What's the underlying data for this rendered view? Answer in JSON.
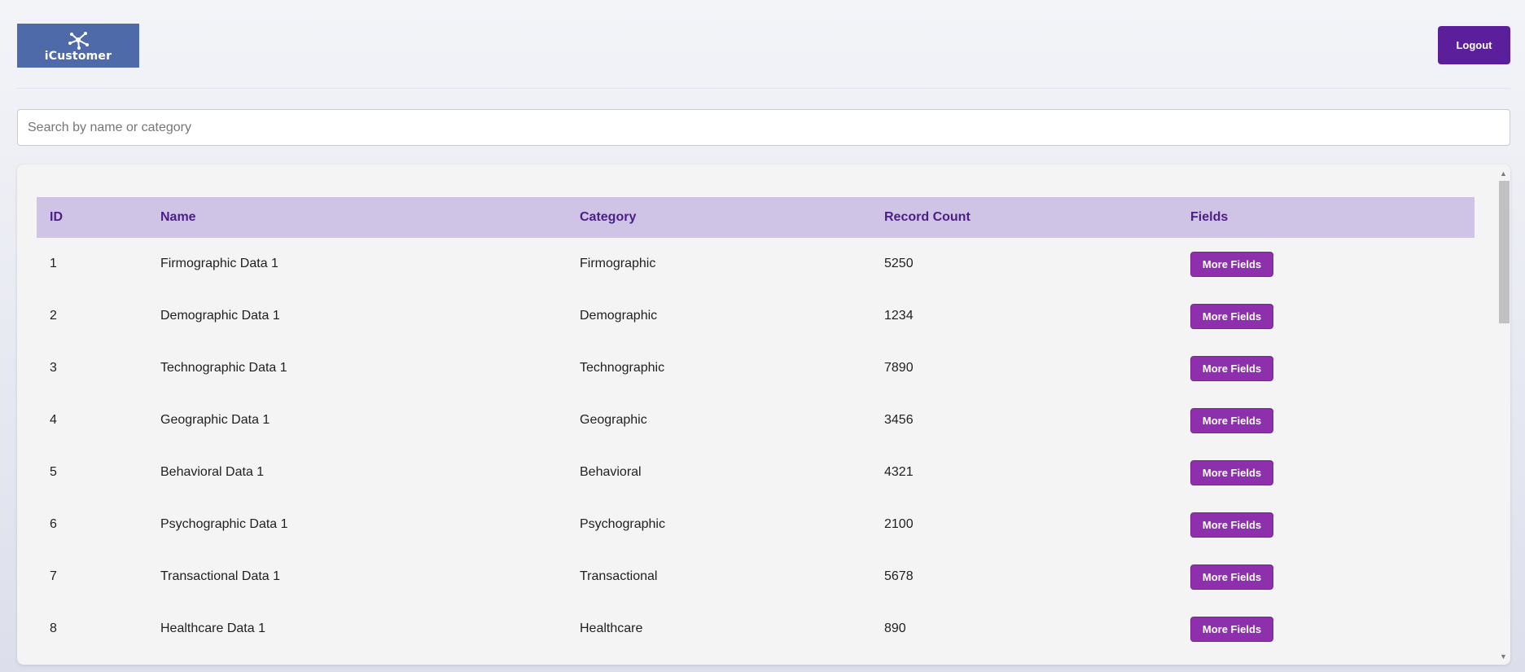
{
  "header": {
    "logo_text": "iCustomer",
    "logout_label": "Logout"
  },
  "search": {
    "placeholder": "Search by name or category",
    "value": ""
  },
  "table": {
    "columns": [
      "ID",
      "Name",
      "Category",
      "Record Count",
      "Fields"
    ],
    "rows": [
      {
        "id": "1",
        "name": "Firmographic Data 1",
        "category": "Firmographic",
        "record_count": "5250",
        "action": "More Fields"
      },
      {
        "id": "2",
        "name": "Demographic Data 1",
        "category": "Demographic",
        "record_count": "1234",
        "action": "More Fields"
      },
      {
        "id": "3",
        "name": "Technographic Data 1",
        "category": "Technographic",
        "record_count": "7890",
        "action": "More Fields"
      },
      {
        "id": "4",
        "name": "Geographic Data 1",
        "category": "Geographic",
        "record_count": "3456",
        "action": "More Fields"
      },
      {
        "id": "5",
        "name": "Behavioral Data 1",
        "category": "Behavioral",
        "record_count": "4321",
        "action": "More Fields"
      },
      {
        "id": "6",
        "name": "Psychographic Data 1",
        "category": "Psychographic",
        "record_count": "2100",
        "action": "More Fields"
      },
      {
        "id": "7",
        "name": "Transactional Data 1",
        "category": "Transactional",
        "record_count": "5678",
        "action": "More Fields"
      },
      {
        "id": "8",
        "name": "Healthcare Data 1",
        "category": "Healthcare",
        "record_count": "890",
        "action": "More Fields"
      }
    ]
  },
  "icons": {
    "logo": "icustomer-logo-icon",
    "scroll_up": "scroll-up-arrow-icon",
    "scroll_down": "scroll-down-arrow-icon"
  },
  "colors": {
    "logo_bg": "#4f6aa8",
    "logout_bg": "#5b1f9c",
    "header_row_bg": "#d0c4e6",
    "header_text": "#4b1e86",
    "button_bg": "#8e2fad"
  }
}
